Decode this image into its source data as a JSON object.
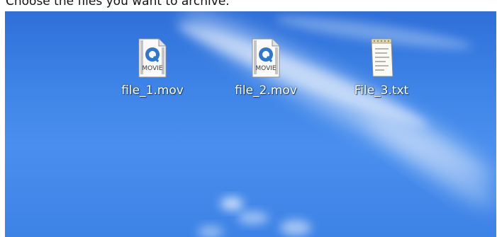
{
  "instruction": "Choose the files you want to archive.",
  "desktop": {
    "icons": [
      {
        "label": "file_1.mov",
        "badge": "MOVIE",
        "type": "quicktime-movie-icon"
      },
      {
        "label": "file_2.mov",
        "badge": "MOVIE",
        "type": "quicktime-movie-icon"
      },
      {
        "label": "File_3.txt",
        "type": "text-document-icon"
      }
    ]
  },
  "colors": {
    "desktop_blue": "#3f85e8",
    "label_text": "#ffffff",
    "quicktime_blue": "#2d76d2"
  }
}
